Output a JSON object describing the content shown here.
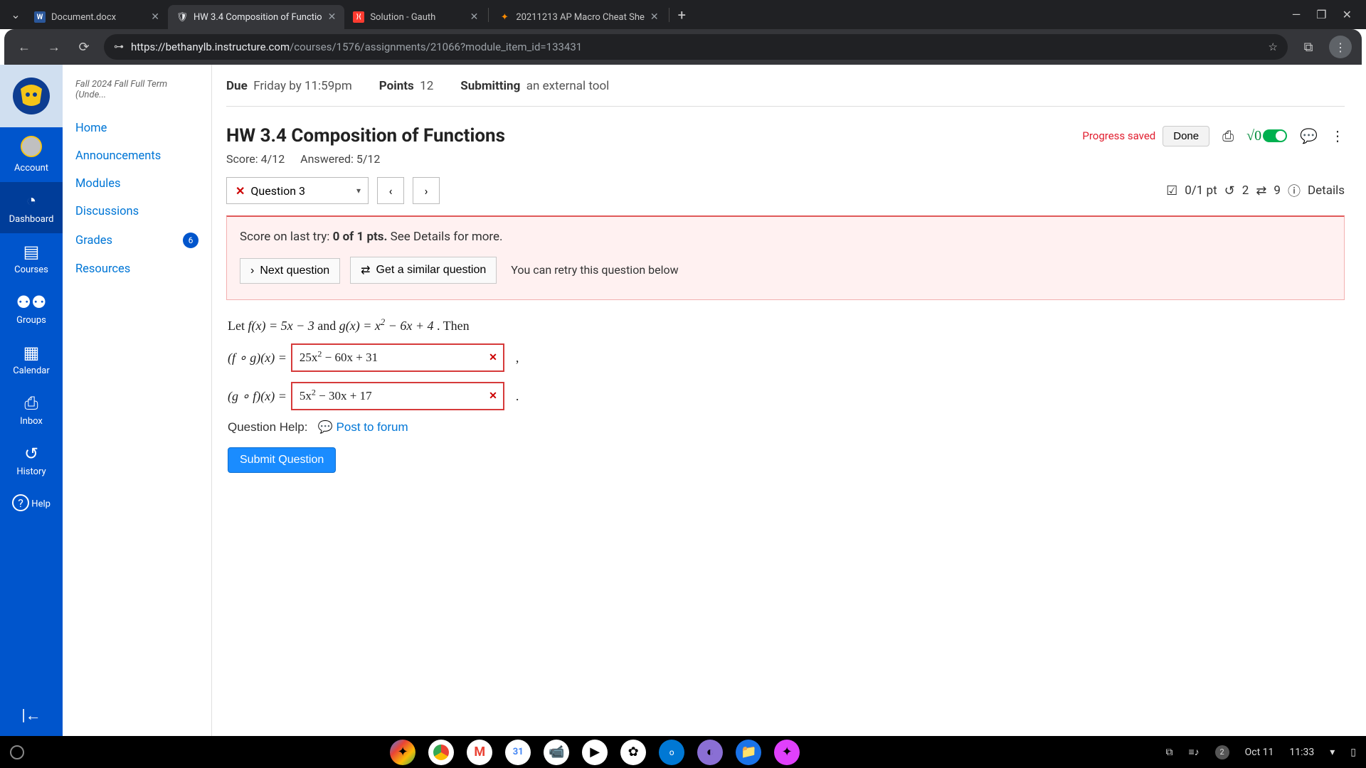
{
  "browser": {
    "tabs": [
      {
        "title": "Document.docx",
        "favicon_letter": "W",
        "favicon_bg": "#2b579a"
      },
      {
        "title": "HW 3.4 Composition of Functio",
        "favicon_letter": "🛡",
        "favicon_bg": "transparent",
        "active": true
      },
      {
        "title": "Solution - Gauth",
        "favicon_letter": "⟩⟨",
        "favicon_bg": "#ff3b30"
      },
      {
        "title": "20211213 AP Macro Cheat She",
        "favicon_letter": "✦",
        "favicon_bg": "transparent"
      }
    ],
    "url_host": "https://bethanylb.instructure.com",
    "url_path": "/courses/1576/assignments/21066?module_item_id=133431"
  },
  "global_nav": [
    {
      "label": "Account",
      "icon": "👤"
    },
    {
      "label": "Dashboard",
      "icon": "🏁",
      "active": true
    },
    {
      "label": "Courses",
      "icon": "📘"
    },
    {
      "label": "Groups",
      "icon": "👥"
    },
    {
      "label": "Calendar",
      "icon": "📅"
    },
    {
      "label": "Inbox",
      "icon": "📥"
    },
    {
      "label": "History",
      "icon": "🕘"
    },
    {
      "label": "Help",
      "icon": "?"
    }
  ],
  "course_nav": {
    "term": "Fall 2024 Fall Full Term (Unde...",
    "items": [
      {
        "label": "Home"
      },
      {
        "label": "Announcements"
      },
      {
        "label": "Modules"
      },
      {
        "label": "Discussions"
      },
      {
        "label": "Grades",
        "badge": "6"
      },
      {
        "label": "Resources"
      }
    ]
  },
  "assignment_header": {
    "due_label": "Due",
    "due_value": "Friday by 11:59pm",
    "points_label": "Points",
    "points_value": "12",
    "submitting_label": "Submitting",
    "submitting_value": "an external tool"
  },
  "homework": {
    "title": "HW 3.4 Composition of Functions",
    "progress_saved": "Progress saved",
    "done": "Done",
    "math_toggle_label": "√0",
    "score_line": "Score: 4/12",
    "answered_line": "Answered: 5/12"
  },
  "question_nav": {
    "current": "Question 3",
    "points": "0/1 pt",
    "retries": "2",
    "attempts": "9",
    "details": "Details"
  },
  "feedback": {
    "prefix": "Score on last try: ",
    "bold": "0 of 1 pts.",
    "suffix": " See Details for more.",
    "next_btn": "Next question",
    "similar_btn": "Get a similar question",
    "retry_text": "You can retry this question below"
  },
  "question": {
    "prompt_prefix": "Let ",
    "f_def": "f(x) = 5x − 3",
    "and": " and ",
    "g_def": "g(x) = x² − 6x + 4",
    "prompt_suffix": ". Then",
    "row1_label": "(f ∘ g)(x) =",
    "row1_value": "25x² − 60x + 31",
    "row1_trail": ",",
    "row2_label": "(g ∘ f)(x) =",
    "row2_value": "5x² − 30x + 17",
    "row2_trail": ".",
    "help_label": "Question Help:",
    "help_link": "Post to forum",
    "submit": "Submit Question"
  },
  "taskbar": {
    "date": "Oct 11",
    "time": "11:33",
    "notif_count": "2"
  }
}
